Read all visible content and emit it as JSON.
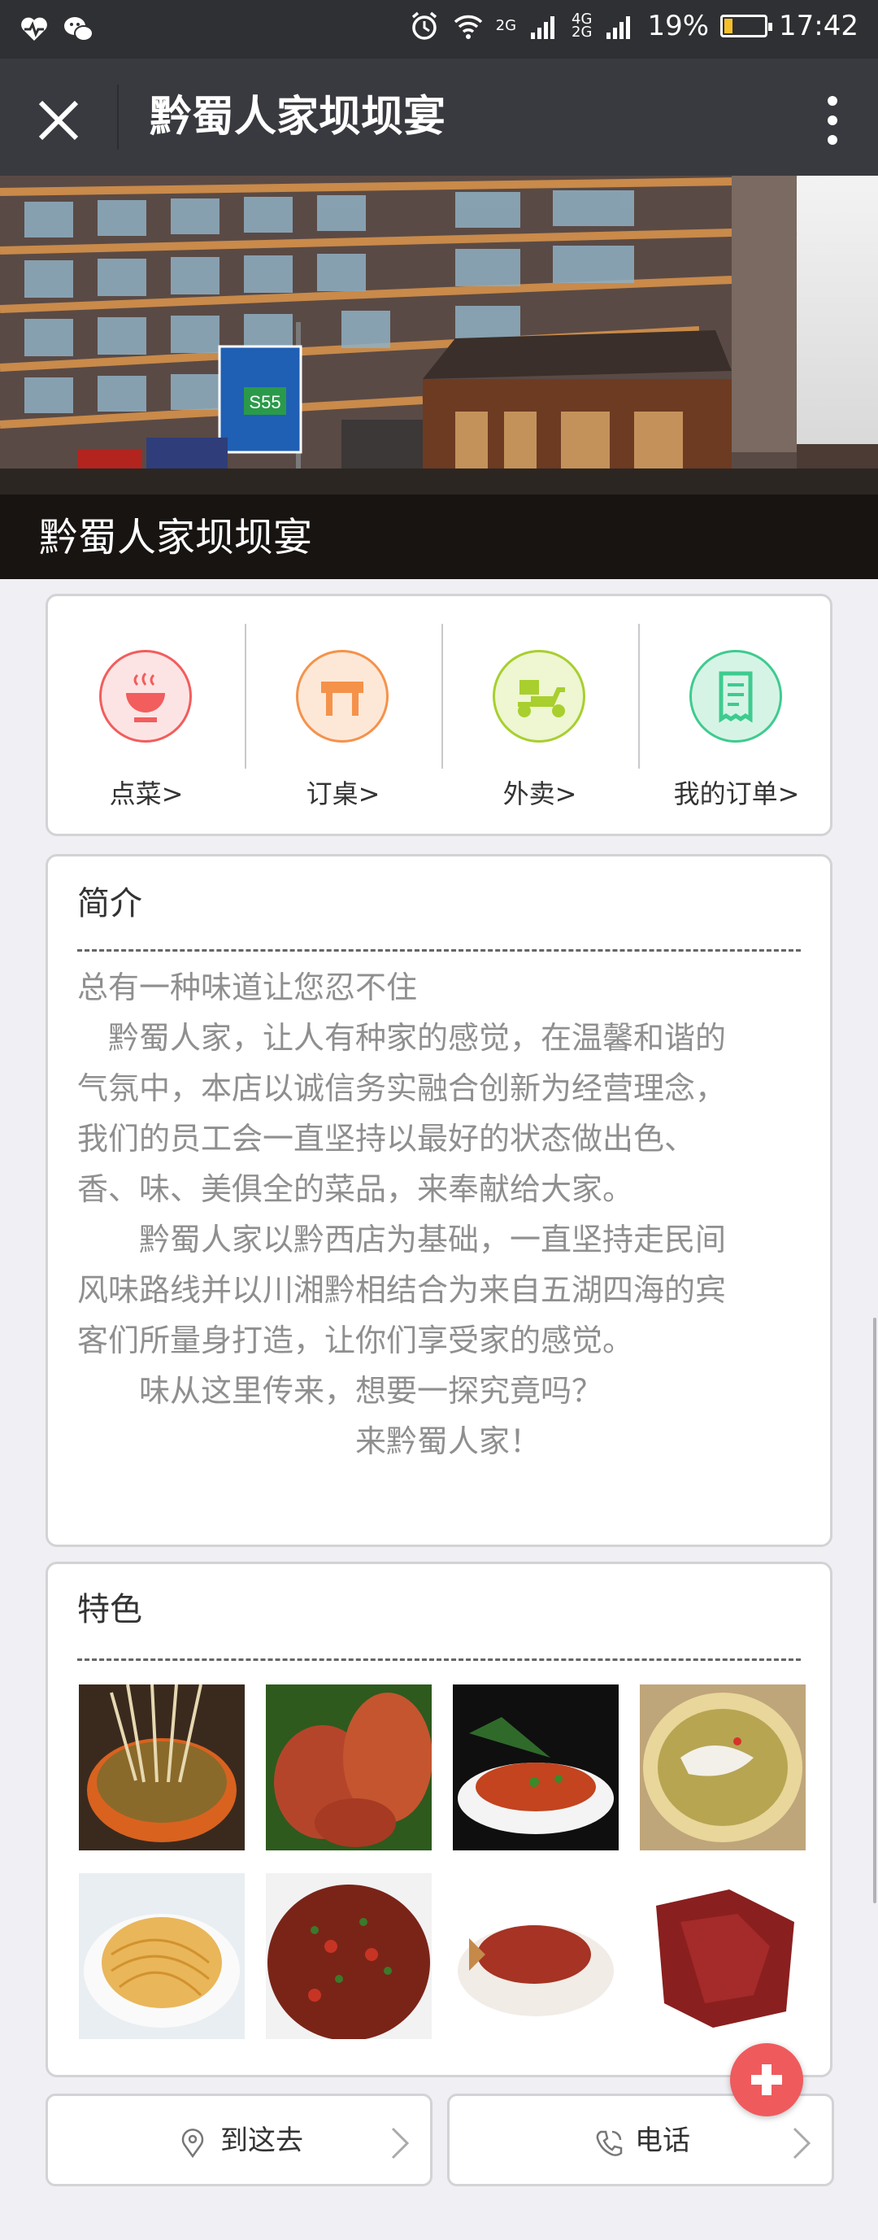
{
  "status_bar": {
    "network_2g": "2G",
    "network_4g": "4G",
    "network_4g_sub": "2G",
    "battery": "19%",
    "battery_level": 0.19,
    "time": "17:42",
    "icons": [
      "heartbeat-icon",
      "wechat-icon",
      "alarm-icon",
      "wifi-icon",
      "signal-icon",
      "battery-icon"
    ]
  },
  "title_bar": {
    "title": "黔蜀人家坝坝宴",
    "close_icon": "close-icon",
    "more_icon": "more-vertical-icon"
  },
  "hero": {
    "name": "黔蜀人家坝坝宴",
    "sign_number": "S55"
  },
  "nav": {
    "items": [
      {
        "label": "点菜>",
        "icon": "bowl-icon",
        "color": "#f25d5d"
      },
      {
        "label": "订桌>",
        "icon": "table-icon",
        "color": "#f5924a"
      },
      {
        "label": "外卖>",
        "icon": "scooter-icon",
        "color": "#a8cf2e"
      },
      {
        "label": "我的订单>",
        "icon": "receipt-icon",
        "color": "#3ecb8f"
      }
    ]
  },
  "intro": {
    "title": "简介",
    "lines": [
      "总有一种味道让您忍不住",
      "　黔蜀人家，让人有种家的感觉，在温馨和谐的",
      "气氛中，本店以诚信务实融合创新为经营理念，",
      "我们的员工会一直坚持以最好的状态做出色、",
      "香、味、美俱全的菜品，来奉献给大家。",
      "　　黔蜀人家以黔西店为基础，一直坚持走民间",
      "风味路线并以川湘黔相结合为来自五湖四海的宾",
      "客们所量身打造，让你们享受家的感觉。",
      "　　味从这里传来，想要一探究竟吗？",
      "　　　　　　　　　来黔蜀人家！"
    ]
  },
  "features": {
    "title": "特色",
    "photos": [
      "skewer-pot-photo",
      "roast-duck-photo",
      "fish-plate-photo",
      "pickled-fish-photo",
      "noodles-photo",
      "spicy-meat-photo",
      "chili-fish-photo",
      "beef-jerky-photo"
    ]
  },
  "actions": {
    "navigate": {
      "label": "到这去",
      "icon": "location-icon"
    },
    "call": {
      "label": "电话",
      "icon": "phone-icon"
    }
  },
  "colors": {
    "status_bar": "#2f3033",
    "title_bar": "#393a3f",
    "background": "#efeff4",
    "fab": "#ef5a5d"
  }
}
